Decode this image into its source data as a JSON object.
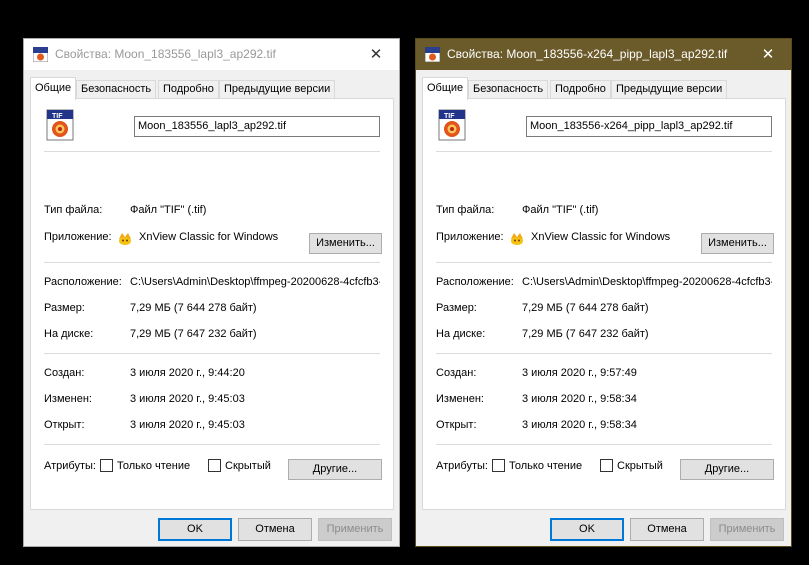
{
  "dialogs": [
    {
      "title": "Свойства: Moon_183556_lapl3_ap292.tif",
      "close_glyph": "✕",
      "tabs": [
        "Общие",
        "Безопасность",
        "Подробно",
        "Предыдущие версии"
      ],
      "filename": "Moon_183556_lapl3_ap292.tif",
      "file_type_label": "Тип файла:",
      "file_type_value": "Файл \"TIF\" (.tif)",
      "app_label": "Приложение:",
      "app_name": "XnView Classic for Windows",
      "change_button": "Изменить...",
      "location_label": "Расположение:",
      "location_value": "C:\\Users\\Admin\\Desktop\\ffmpeg-20200628-4cfcfb3-",
      "size_label": "Размер:",
      "size_value": "7,29 МБ (7 644 278 байт)",
      "disk_label": "На диске:",
      "disk_value": "7,29 МБ (7 647 232 байт)",
      "created_label": "Создан:",
      "created_value": "3 июля 2020 г., 9:44:20",
      "modified_label": "Изменен:",
      "modified_value": "3 июля 2020 г., 9:45:03",
      "opened_label": "Открыт:",
      "opened_value": "3 июля 2020 г., 9:45:03",
      "attributes_label": "Атрибуты:",
      "readonly_label": "Только чтение",
      "hidden_label": "Скрытый",
      "other_button": "Другие...",
      "ok_button": "OK",
      "cancel_button": "Отмена",
      "apply_button": "Применить"
    },
    {
      "title": "Свойства: Moon_183556-x264_pipp_lapl3_ap292.tif",
      "close_glyph": "✕",
      "tabs": [
        "Общие",
        "Безопасность",
        "Подробно",
        "Предыдущие версии"
      ],
      "filename": "Moon_183556-x264_pipp_lapl3_ap292.tif",
      "file_type_label": "Тип файла:",
      "file_type_value": "Файл \"TIF\" (.tif)",
      "app_label": "Приложение:",
      "app_name": "XnView Classic for Windows",
      "change_button": "Изменить...",
      "location_label": "Расположение:",
      "location_value": "C:\\Users\\Admin\\Desktop\\ffmpeg-20200628-4cfcfb3-",
      "size_label": "Размер:",
      "size_value": "7,29 МБ (7 644 278 байт)",
      "disk_label": "На диске:",
      "disk_value": "7,29 МБ (7 647 232 байт)",
      "created_label": "Создан:",
      "created_value": "3 июля 2020 г., 9:57:49",
      "modified_label": "Изменен:",
      "modified_value": "3 июля 2020 г., 9:58:34",
      "opened_label": "Открыт:",
      "opened_value": "3 июля 2020 г., 9:58:34",
      "attributes_label": "Атрибуты:",
      "readonly_label": "Только чтение",
      "hidden_label": "Скрытый",
      "other_button": "Другие...",
      "ok_button": "OK",
      "cancel_button": "Отмена",
      "apply_button": "Применить"
    }
  ],
  "icons": {
    "file": "tif-file-icon",
    "app": "xnview-app-icon",
    "close": "close-icon"
  },
  "colors": {
    "active_titlebar": "#6b5a2a",
    "ok_focus_border": "#0078d7",
    "panel_background": "#ffffff",
    "dialog_background": "#f0f0f0"
  }
}
